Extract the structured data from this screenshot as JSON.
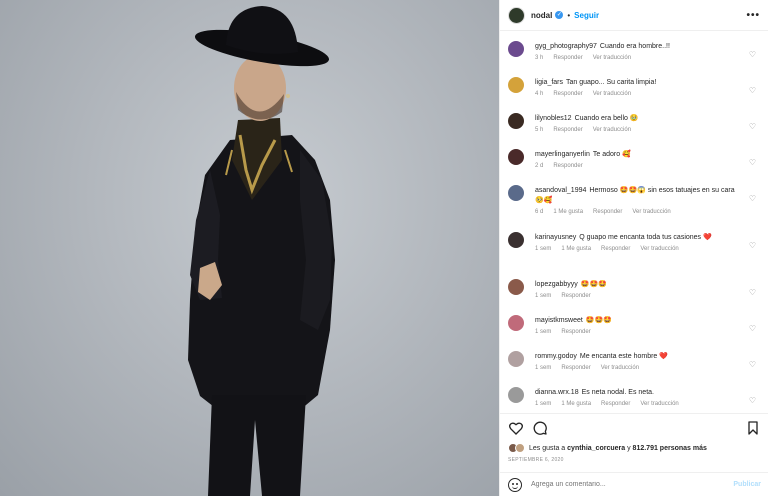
{
  "header": {
    "username": "nodal",
    "separator": "•",
    "follow_label": "Seguir",
    "more_label": "•••"
  },
  "comments": [
    {
      "user": "gyg_photography97",
      "text": "Cuando era hombre..!!",
      "time": "3 h",
      "likes": "",
      "reply": "Responder",
      "translate": "Ver traducción",
      "avatar_color": "#6b4a8e"
    },
    {
      "user": "ligia_fars",
      "text": "Tan guapo... Su carita limpia!",
      "time": "4 h",
      "likes": "",
      "reply": "Responder",
      "translate": "Ver traducción",
      "avatar_color": "#d4a23a"
    },
    {
      "user": "lilynobles12",
      "text": "Cuando era bello 🥹",
      "time": "5 h",
      "likes": "",
      "reply": "Responder",
      "translate": "Ver traducción",
      "avatar_color": "#3a2a22"
    },
    {
      "user": "mayerlinganyerlin",
      "text": "Te adoro 🥰",
      "time": "2 d",
      "likes": "",
      "reply": "Responder",
      "translate": "",
      "avatar_color": "#4a2a2a"
    },
    {
      "user": "asandoval_1994",
      "text": "Hermoso 🤩🤩😱 sin esos tatuajes en su cara 🥺🥰",
      "time": "6 d",
      "likes": "1 Me gusta",
      "reply": "Responder",
      "translate": "Ver traducción",
      "avatar_color": "#5a6a8a"
    },
    {
      "user": "karinayusney",
      "text": "Q guapo me encanta toda tus casiones ❤️",
      "time": "1 sem",
      "likes": "1 Me gusta",
      "reply": "Responder",
      "translate": "Ver traducción",
      "avatar_color": "#3a3030"
    },
    {
      "user": "lopezgabbyyy",
      "text": "🤩🤩🤩",
      "time": "1 sem",
      "likes": "",
      "reply": "Responder",
      "translate": "",
      "avatar_color": "#8a5a4a"
    },
    {
      "user": "mayistkmsweet",
      "text": "🤩🤩🤩",
      "time": "1 sem",
      "likes": "",
      "reply": "Responder",
      "translate": "",
      "avatar_color": "#c06a7a"
    },
    {
      "user": "rommy.godoy",
      "text": "Me encanta este hombre ❤️",
      "time": "1 sem",
      "likes": "",
      "reply": "Responder",
      "translate": "Ver traducción",
      "avatar_color": "#b0a0a0"
    },
    {
      "user": "dianna.wrx.18",
      "text": "Es neta nodal. Es neta.",
      "time": "1 sem",
      "likes": "1 Me gusta",
      "reply": "Responder",
      "translate": "Ver traducción",
      "avatar_color": "#9a9a9a"
    }
  ],
  "likes": {
    "prefix": "Les gusta a",
    "user": "cynthia_corcuera",
    "middle": "y",
    "count": "812.791 personas más"
  },
  "date": "SEPTIEMBRE 6, 2020",
  "add_comment": {
    "placeholder": "Agrega un comentario...",
    "publish_label": "Publicar"
  },
  "colors": {
    "accent": "#0095f6",
    "publish_disabled": "#b2dffc",
    "muted": "#8e8e8e"
  }
}
